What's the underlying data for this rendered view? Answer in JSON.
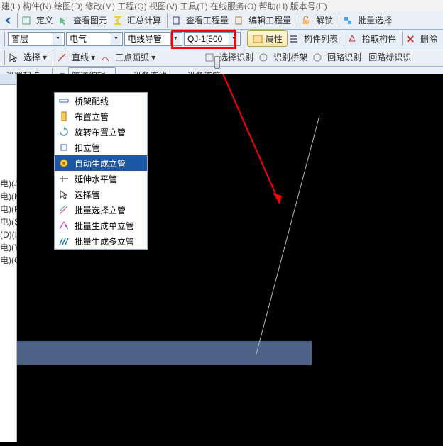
{
  "menubar": {
    "partial": "建(L) 构件(N) 绘图(D) 修改(M) 工程(Q) 视图(V) 工具(T) 在线服务(O) 帮助(H) 版本号(E)"
  },
  "toolbar1": {
    "define": "定义",
    "view_tuyuan": "查看图元",
    "sum_calc": "汇总计算",
    "view_gcl": "查看工程量",
    "edit_gcl": "编辑工程量",
    "unlock": "解锁",
    "batch_select": "批量选择"
  },
  "toolbar2": {
    "floor": "首层",
    "domain": "电气",
    "category": "电线导管",
    "item": "QJ-1[500",
    "props": "属性",
    "component_list": "构件列表",
    "pick": "拾取构件",
    "delete": "删除"
  },
  "toolbar3": {
    "select": "选择",
    "line": "直线",
    "arc": "三点画弧",
    "sel_rec": "选择识别",
    "rec_bridge": "识别桥架",
    "loop_rec": "回路识别",
    "loop_mark": "回路标识识"
  },
  "toolbar4": {
    "set_start": "设置起点",
    "pipe_edit": "管道编辑",
    "dev_line": "设备连线",
    "dev_pipe": "设备连管"
  },
  "dropdown_menu": {
    "items": [
      {
        "icon": "bridge",
        "label": "桥架配线"
      },
      {
        "icon": "layout",
        "label": "布置立管"
      },
      {
        "icon": "rotate",
        "label": "旋转布置立管"
      },
      {
        "icon": "clip",
        "label": "扣立管"
      },
      {
        "icon": "auto",
        "label": "自动生成立管",
        "selected": true
      },
      {
        "icon": "extend",
        "label": "延伸水平管"
      },
      {
        "icon": "choose",
        "label": "选择管"
      },
      {
        "icon": "batch_sel",
        "label": "批量选择立管"
      },
      {
        "icon": "gen_single",
        "label": "批量生成单立管"
      },
      {
        "icon": "gen_multi",
        "label": "批量生成多立管"
      }
    ]
  },
  "left_panel": {
    "items": [
      "电)(J)",
      "电)(K)",
      "电)(P)",
      "电)(S)",
      "(D)(I)",
      "电)(Y)",
      "电)(O)"
    ]
  }
}
